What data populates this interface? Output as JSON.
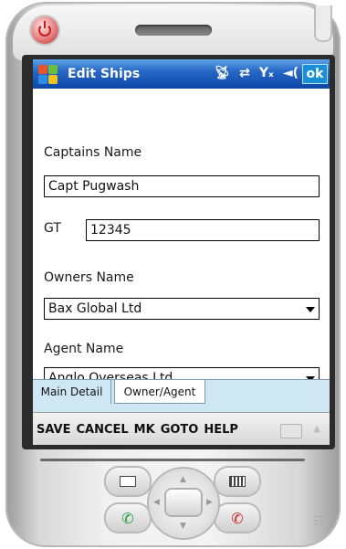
{
  "window": {
    "title": "Edit Ships",
    "ok_label": "ok"
  },
  "status_icons": [
    "signal-icon",
    "sync-icon",
    "no-signal-icon",
    "volume-icon"
  ],
  "form": {
    "captains_name_label": "Captains Name",
    "captains_name_value": "Capt Pugwash",
    "gt_label": "GT",
    "gt_value": "12345",
    "owners_name_label": "Owners Name",
    "owners_name_value": "Bax Global Ltd",
    "agent_name_label": "Agent Name",
    "agent_name_value": "Anglo Overseas Ltd"
  },
  "tabs": [
    {
      "label": "Main Detail",
      "active": true
    },
    {
      "label": "Owner/Agent",
      "active": false
    }
  ],
  "menu": [
    "SAVE",
    "CANCEL",
    "MK",
    "GOTO",
    "HELP"
  ],
  "colors": {
    "titlebar": "#0c47a8",
    "tabbar": "#cfe7f3",
    "power": "#c41d1d",
    "call_green": "#1f9a3a",
    "end_red": "#d22020"
  }
}
